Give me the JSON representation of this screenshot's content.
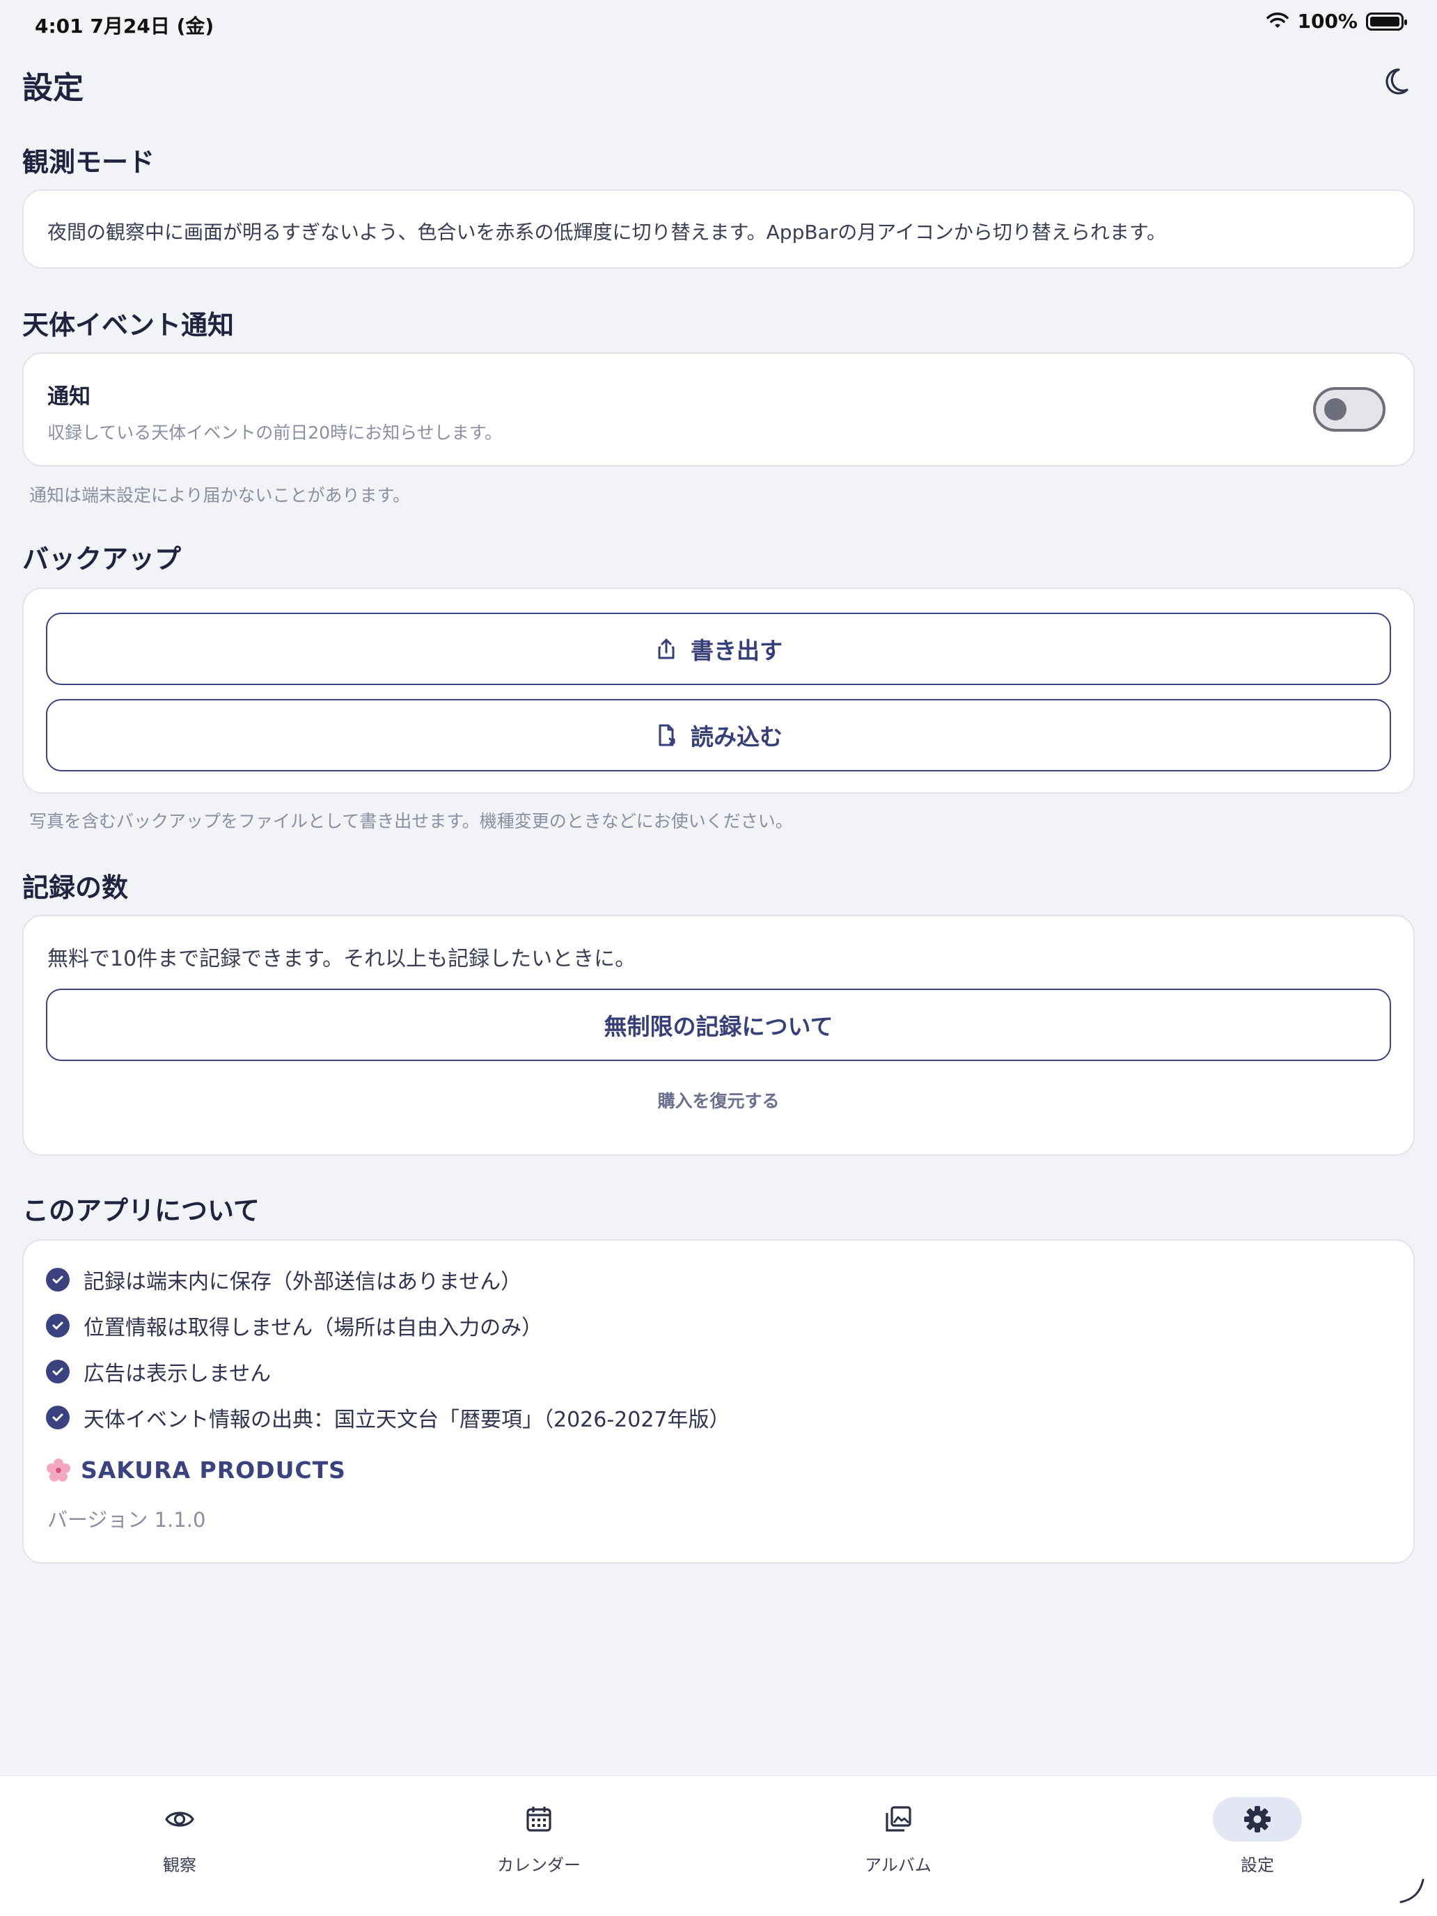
{
  "status_bar": {
    "time_date": "4:01  7月24日 (金)",
    "battery": "100%"
  },
  "app_bar": {
    "title": "設定",
    "action_icon": "moon-icon"
  },
  "observation_mode": {
    "title": "観測モード",
    "description": "夜間の観察中に画面が明るすぎないよう、色合いを赤系の低輝度に切り替えます。AppBarの月アイコンから切り替えられます。"
  },
  "notifications": {
    "title": "天体イベント通知",
    "toggle_label": "通知",
    "toggle_sublabel": "収録している天体イベントの前日20時にお知らせします。",
    "toggle_on": false,
    "note": "通知は端末設定により届かないことがあります。"
  },
  "backup": {
    "title": "バックアップ",
    "export_label": "書き出す",
    "import_label": "読み込む",
    "note": "写真を含むバックアップをファイルとして書き出せます。機種変更のときなどにお使いください。"
  },
  "records": {
    "title": "記録の数",
    "description": "無料で10件まで記録できます。それ以上も記録したいときに。",
    "unlimited_label": "無制限の記録について",
    "restore_label": "購入を復元する"
  },
  "about": {
    "title": "このアプリについて",
    "items": [
      "記録は端末内に保存（外部送信はありません）",
      "位置情報は取得しません（場所は自由入力のみ）",
      "広告は表示しません",
      "天体イベント情報の出典：国立天文台「暦要項」（2026-2027年版）"
    ],
    "brand": "SAKURA PRODUCTS",
    "version": "バージョン 1.1.0"
  },
  "bottom_nav": [
    {
      "label": "観察",
      "icon": "eye-icon",
      "active": false
    },
    {
      "label": "カレンダー",
      "icon": "calendar-icon",
      "active": false
    },
    {
      "label": "アルバム",
      "icon": "album-icon",
      "active": false
    },
    {
      "label": "設定",
      "icon": "gear-icon",
      "active": true
    }
  ],
  "colors": {
    "accent": "#3a4380",
    "background": "#f2f3f7",
    "card": "#ffffff"
  }
}
